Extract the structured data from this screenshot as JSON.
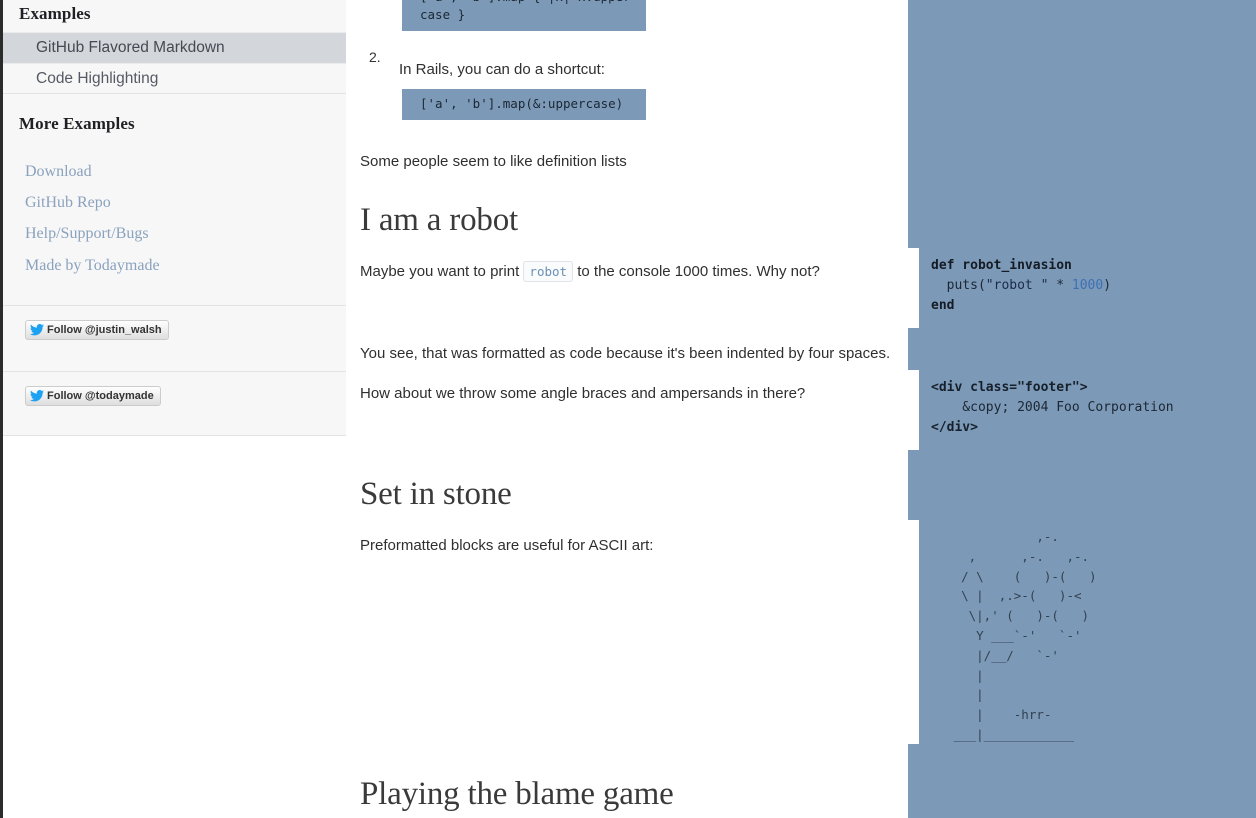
{
  "colors": {
    "sidebar_bg": "#f7f7f7",
    "sidebar_active": "#d3d6da",
    "sidebar_link": "#8aa2bd",
    "code_bg": "#7c9ab8",
    "page_bg": "#ffffff",
    "left_rule": "#2b2b2b",
    "inline_code_text": "#6a8fb5",
    "twitter_blue": "#1da1f2"
  },
  "sidebar": {
    "examples_heading": "Examples",
    "nav_items": [
      {
        "label": "GitHub Flavored Markdown",
        "active": true
      },
      {
        "label": "Code Highlighting",
        "active": false
      }
    ],
    "more_examples_heading": "More Examples",
    "links": [
      {
        "label": "Download"
      },
      {
        "label": "GitHub Repo"
      },
      {
        "label": "Help/Support/Bugs"
      },
      {
        "label": "Made by Todaymade"
      }
    ],
    "twitter_buttons": [
      {
        "label": "Follow @justin_walsh",
        "icon": "twitter-bird-icon"
      },
      {
        "label": "Follow @todaymade",
        "icon": "twitter-bird-icon"
      }
    ]
  },
  "main": {
    "code_block_top": "['a', 'b'].map { |x| x.uppercase }",
    "list": {
      "marker": "2.",
      "item_text": "In Rails, you can do a shortcut:",
      "code": "['a', 'b'].map(&:uppercase)"
    },
    "definition_lists_text": "Some people seem to like definition lists",
    "heading_robot": "I am a robot",
    "robot_para_before": "Maybe you want to print ",
    "robot_inline_code": "robot",
    "robot_para_after": " to the console 1000 times. Why not?",
    "four_spaces_text": "You see, that was formatted as code because it's been indented by four spaces.",
    "angle_braces_text": "How about we throw some angle braces and ampersands in there?",
    "heading_stone": "Set in stone",
    "preformatted_text": "Preformatted blocks are useful for ASCII art:",
    "heading_blame": "Playing the blame game"
  },
  "right_panel": {
    "ruby_block": {
      "line1_kw": "def",
      "line1_name": " robot_invasion",
      "line2_pre": "  puts(",
      "line2_str": "\"robot \"",
      "line2_op": " * ",
      "line2_num": "1000",
      "line2_post": ")",
      "line3": "end"
    },
    "html_block": {
      "line1": "<div class=\"footer\">",
      "line2": "    &copy; 2004 Foo Corporation",
      "line3": "</div>"
    },
    "ascii_art": "              ,-.\n     ,      ,-.   ,-.\n    / \\    (   )-(   )\n    \\ |  ,.>-(   )-<\n     \\|,' (   )-(   )\n      Y ___`-'   `-'\n      |/__/   `-'\n      |\n      |\n      |    -hrr-\n   ___|____________"
  }
}
